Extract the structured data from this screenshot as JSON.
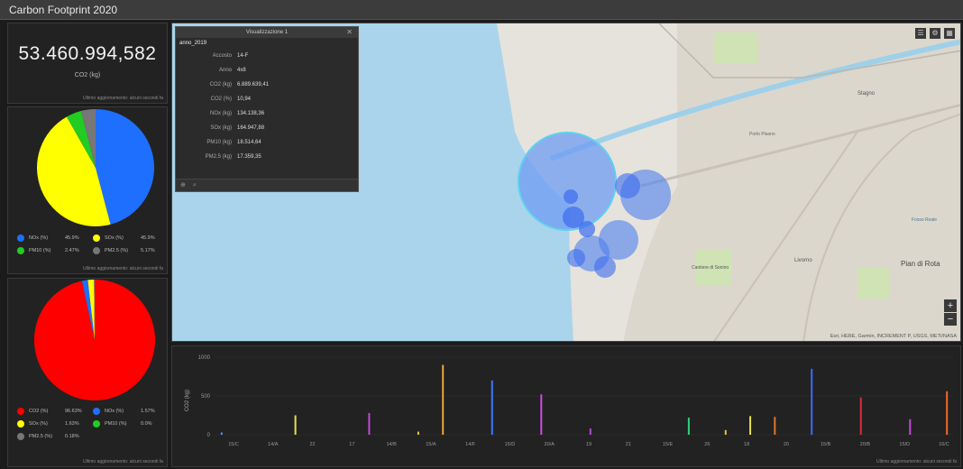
{
  "app": {
    "title": "Carbon Footprint 2020"
  },
  "kpi": {
    "value": "53.460.994,582",
    "label": "CO2 (kg)",
    "updated": "Ultimo aggiornamento: alcuni secondi fa"
  },
  "pie1": {
    "updated": "Ultimo aggiornamento: alcuni secondi fa",
    "slices": [
      {
        "label": "NOx (%)",
        "pct": "45.9%",
        "value": 45.9,
        "color": "#1f6fff"
      },
      {
        "label": "SOx (%)",
        "pct": "45.9%",
        "value": 45.9,
        "color": "#ffff00"
      },
      {
        "label": "PM10 (%)",
        "pct": "2.47%",
        "value": 4.2,
        "color": "#22cc22"
      },
      {
        "label": "PM2.5 (%)",
        "pct": "5.17%",
        "value": 4.0,
        "color": "#777777"
      }
    ]
  },
  "pie2": {
    "updated": "Ultimo aggiornamento: alcuni secondi fa",
    "slices": [
      {
        "label": "CO2 (%)",
        "pct": "96.63%",
        "value": 96.63,
        "color": "#ff0000"
      },
      {
        "label": "NOx (%)",
        "pct": "1.57%",
        "value": 1.57,
        "color": "#1f6fff"
      },
      {
        "label": "SOx (%)",
        "pct": "1.63%",
        "value": 1.63,
        "color": "#ffff00"
      },
      {
        "label": "PM10 (%)",
        "pct": "0.0%",
        "value": 0.0,
        "color": "#22cc22"
      },
      {
        "label": "PM2.5 (%)",
        "pct": "0.18%",
        "value": 0.18,
        "color": "#777777"
      }
    ]
  },
  "popup": {
    "title": "Visualizzazione 1",
    "layer": "anno_2019",
    "close": "✕",
    "rows": [
      {
        "key": "Accosto",
        "value": "14-F"
      },
      {
        "key": "Anno",
        "value": "4x8"
      },
      {
        "key": "CO2 (kg)",
        "value": "6.889.639,41"
      },
      {
        "key": "CO2 (%)",
        "value": "10,94"
      },
      {
        "key": "NOx (kg)",
        "value": "134.138,36"
      },
      {
        "key": "SOx (kg)",
        "value": "164.947,88"
      },
      {
        "key": "PM10 (kg)",
        "value": "18.514,64"
      },
      {
        "key": "PM2.5 (kg)",
        "value": "17.359,35"
      }
    ]
  },
  "map": {
    "labels": [
      "Cantiere di Sonino",
      "Pian di Rota",
      "Stagno",
      "Porto Pisano",
      "Livorno",
      "Fosso Reale"
    ],
    "attribution": "Esri, HERE, Garmin, INCREMENT P, USGS, METI/NASA",
    "tools": [
      "list-icon",
      "settings-icon",
      "grid-icon"
    ],
    "zoom_in": "+",
    "zoom_out": "−"
  },
  "chart_data": {
    "type": "bar",
    "ylabel": "CO2 (kg)",
    "ylim": [
      0,
      1000
    ],
    "yticks": [
      "0",
      "500",
      "1000"
    ],
    "categories": [
      "15/C",
      "",
      "14/A",
      "",
      "22",
      "",
      "17",
      "",
      "14/B",
      "",
      "15/A",
      "",
      "14/F",
      "",
      "15/D",
      "",
      "20/A",
      "",
      "19",
      "",
      "21",
      "",
      "15/E",
      "",
      "26",
      "",
      "18",
      "",
      "20",
      "",
      "15/B",
      "",
      "20/B",
      "",
      "15/D",
      "",
      "16/C"
    ],
    "values": [
      30,
      0,
      0,
      0,
      0,
      0,
      250,
      0,
      0,
      0,
      0,
      0,
      280,
      0,
      0,
      0,
      40,
      0,
      900,
      0,
      0,
      0,
      700,
      0,
      0,
      0,
      520,
      0,
      0,
      0,
      80,
      0,
      0,
      0,
      0,
      0,
      0,
      0,
      220,
      0,
      0,
      60,
      0,
      240,
      0,
      230,
      0,
      0,
      850,
      0,
      0,
      0,
      480,
      0,
      0,
      0,
      200,
      0,
      0,
      560
    ],
    "colors": [
      "#5a8dff",
      "#8a8a8a",
      "#8a8a8a",
      "#8a8a8a",
      "#8a8a8a",
      "#8a8a8a",
      "#e6e04a",
      "#8a8a8a",
      "#8a8a8a",
      "#8a8a8a",
      "#8a8a8a",
      "#8a8a8a",
      "#c04ad6",
      "#8a8a8a",
      "#8a8a8a",
      "#8a8a8a",
      "#e6c24a",
      "#8a8a8a",
      "#f0a23a",
      "#8a8a8a",
      "#8a8a8a",
      "#8a8a8a",
      "#3a7aff",
      "#8a8a8a",
      "#8a8a8a",
      "#8a8a8a",
      "#d04ae0",
      "#8a8a8a",
      "#8a8a8a",
      "#8a8a8a",
      "#b04ad0",
      "#8a8a8a",
      "#8a8a8a",
      "#8a8a8a",
      "#8a8a8a",
      "#8a8a8a",
      "#8a8a8a",
      "#8a8a8a",
      "#2ed47a",
      "#8a8a8a",
      "#8a8a8a",
      "#e6c24a",
      "#8a8a8a",
      "#e6e04a",
      "#8a8a8a",
      "#e0762a",
      "#8a8a8a",
      "#8a8a8a",
      "#3a6bff",
      "#8a8a8a",
      "#8a8a8a",
      "#8a8a8a",
      "#e02a3a",
      "#8a8a8a",
      "#8a8a8a",
      "#8a8a8a",
      "#c04ad6",
      "#8a8a8a",
      "#8a8a8a",
      "#f06a2a"
    ],
    "xtick_labels": [
      "15/C",
      "14/A",
      "22",
      "17",
      "14/B",
      "15/A",
      "14/F",
      "15/D",
      "20/A",
      "19",
      "21",
      "15/E",
      "26",
      "18",
      "20",
      "15/B",
      "20/B",
      "15/D",
      "16/C"
    ],
    "updated": "Ultimo aggiornamento: alcuni secondi fa"
  }
}
